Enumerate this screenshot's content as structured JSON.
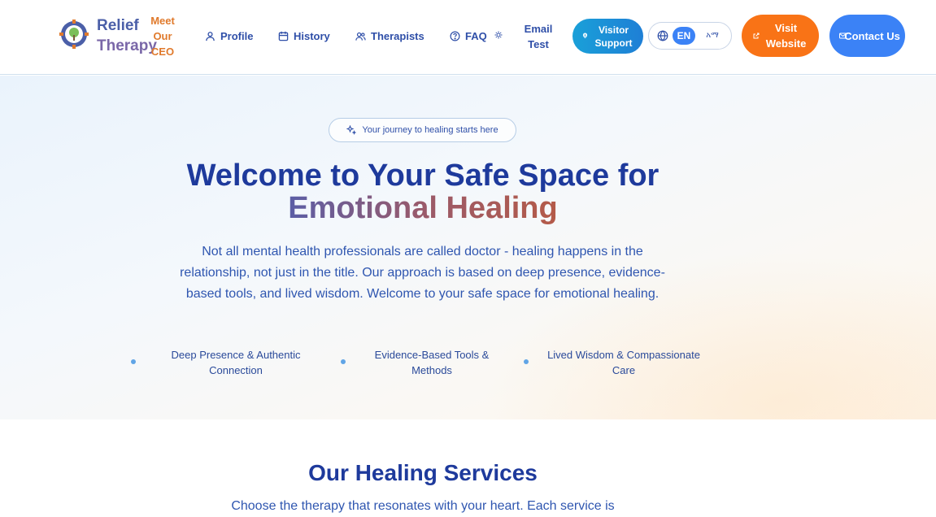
{
  "header": {
    "brand_line1": "Relief",
    "brand_line2": "Therapy",
    "meet_ceo": "Meet Our CEO",
    "nav": {
      "profile": "Profile",
      "history": "History",
      "therapists": "Therapists",
      "faq": "FAQ",
      "email_test": "Email Test"
    },
    "visitor_support": "Visitor Support",
    "language": {
      "en": "EN",
      "am": "አማ"
    },
    "visit_website": "Visit Website",
    "contact_us": "Contact Us"
  },
  "hero": {
    "badge": "Your journey to healing starts here",
    "title_line1": "Welcome to Your Safe Space for",
    "title_accent": "Emotional Healing",
    "lead": "Not all mental health professionals are called doctor - healing happens in the relationship, not just in the title. Our approach is based on deep presence, evidence-based tools, and lived wisdom. Welcome to your safe space for emotional healing.",
    "features": [
      "Deep Presence & Authentic Connection",
      "Evidence-Based Tools & Methods",
      "Lived Wisdom & Compassionate Care"
    ]
  },
  "services": {
    "title": "Our Healing Services",
    "subtitle": "Choose the therapy that resonates with your heart. Each service is"
  },
  "colors": {
    "primary_blue": "#1e3a9c",
    "orange": "#f97316",
    "button_blue": "#3b82f6",
    "cyan": "#1aa0d8"
  }
}
